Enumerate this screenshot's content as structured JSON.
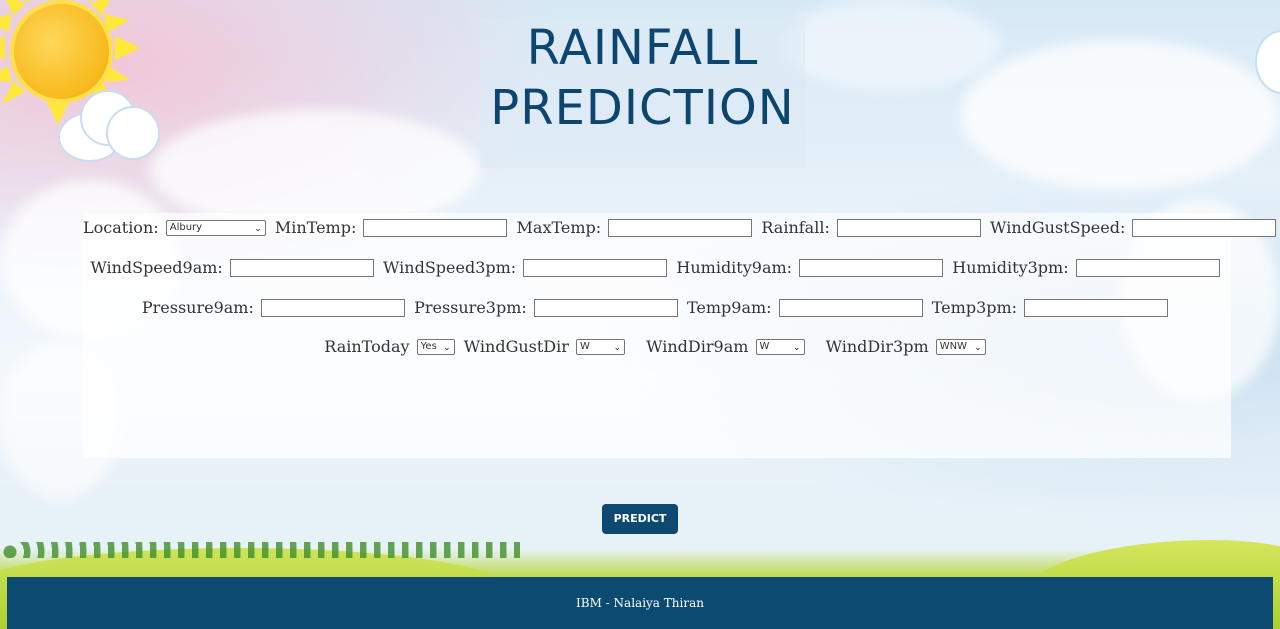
{
  "header": {
    "title_line1": "RAINFALL",
    "title_line2": "PREDICTION"
  },
  "form": {
    "row1": {
      "location_label": "Location:",
      "location_value": "Albury",
      "mintemp_label": "MinTemp:",
      "maxtemp_label": "MaxTemp:",
      "rainfall_label": "Rainfall:",
      "windgustspeed_label": "WindGustSpeed:"
    },
    "row2": {
      "windspeed9am_label": "WindSpeed9am:",
      "windspeed3pm_label": "WindSpeed3pm:",
      "humidity9am_label": "Humidity9am:",
      "humidity3pm_label": "Humidity3pm:"
    },
    "row3": {
      "pressure9am_label": "Pressure9am:",
      "pressure3pm_label": "Pressure3pm:",
      "temp9am_label": "Temp9am:",
      "temp3pm_label": "Temp3pm:"
    },
    "row4": {
      "raintoday_label": "RainToday",
      "raintoday_value": "Yes",
      "windgustdir_label": "WindGustDir",
      "windgustdir_value": "W",
      "winddir9am_label": "WindDir9am",
      "winddir9am_value": "W",
      "winddir3pm_label": "WindDir3pm",
      "winddir3pm_value": "WNW"
    }
  },
  "actions": {
    "predict_label": "PREDICT"
  },
  "footer": {
    "text": "IBM - Nalaiya Thiran"
  },
  "colors": {
    "brand": "#0c4a72",
    "title": "#0c4670"
  },
  "icons": {
    "sun": "sun-icon",
    "cloud": "cloud-icon",
    "chevron": "chevron-down-icon"
  }
}
